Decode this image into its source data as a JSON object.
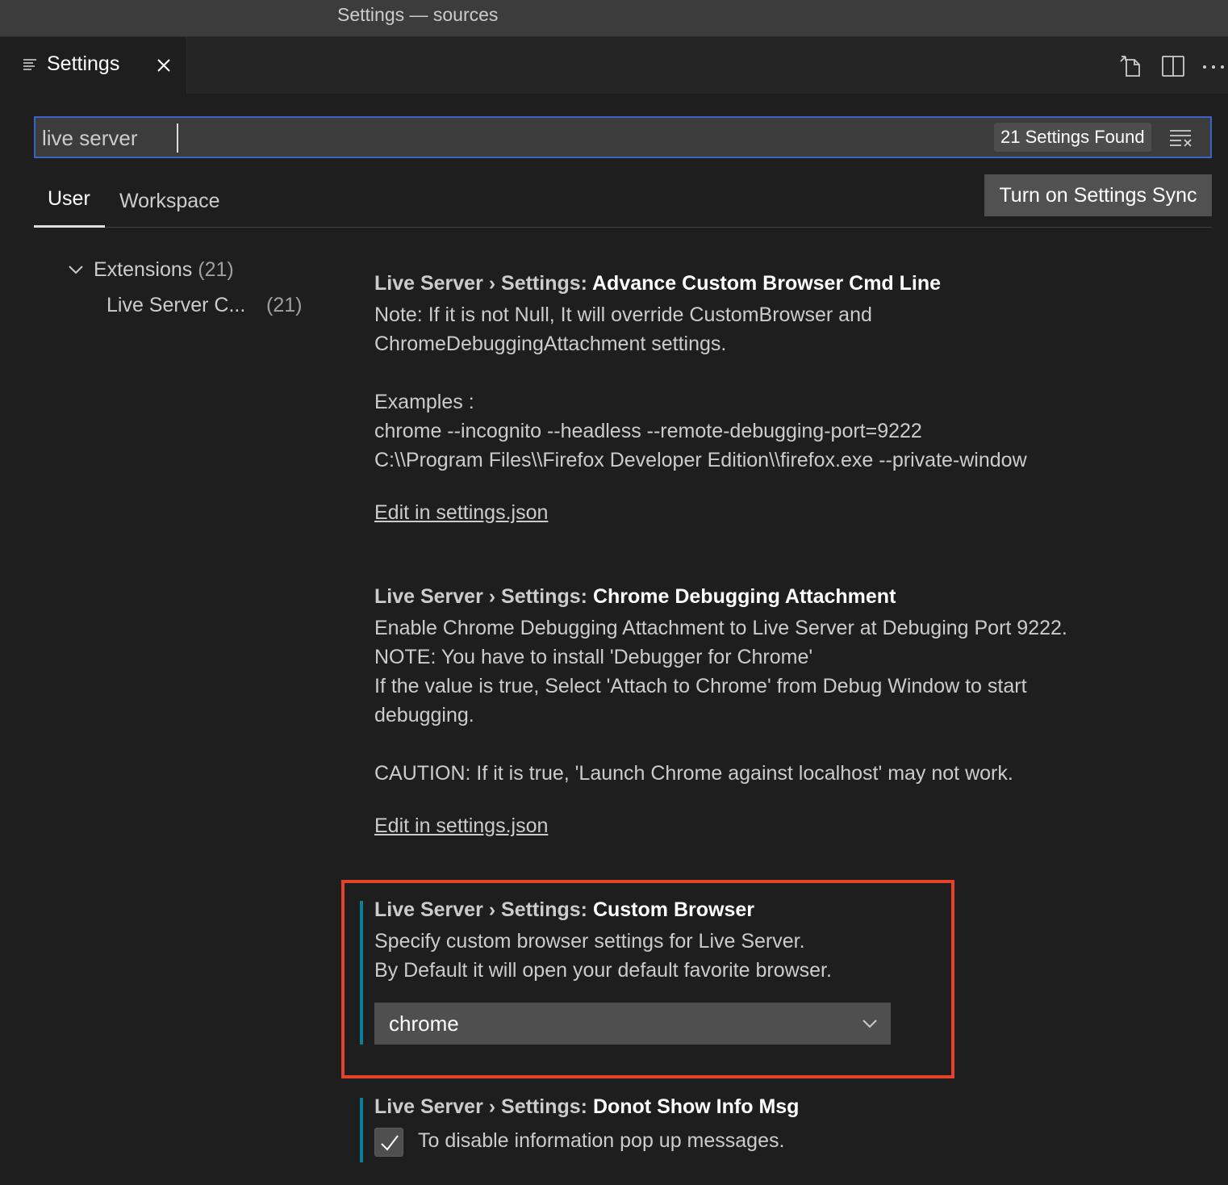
{
  "window": {
    "title": "Settings — sources"
  },
  "editor_tab": {
    "label": "Settings",
    "icon": "settings-list-icon",
    "close_icon": "close-icon"
  },
  "tab_actions": [
    {
      "name": "open-settings-json-icon"
    },
    {
      "name": "split-editor-icon"
    },
    {
      "name": "more-actions-icon"
    }
  ],
  "search": {
    "value": "live server",
    "results_badge": "21 Settings Found",
    "clear_icon": "clear-filter-icon"
  },
  "scope_tabs": {
    "user": "User",
    "workspace": "Workspace",
    "active": "User"
  },
  "sync_button": {
    "label": "Turn on Settings Sync"
  },
  "toc": {
    "extensions": {
      "label": "Extensions",
      "count": "(21)"
    },
    "live_server": {
      "label": "Live Server C...",
      "count": "(21)"
    }
  },
  "settings": [
    {
      "category": "Live Server › Settings: ",
      "name": "Advance Custom Browser Cmd Line",
      "description": [
        "Note: If it is not Null, It will override CustomBrowser and",
        "ChromeDebuggingAttachment settings.",
        "",
        "Examples :",
        "chrome --incognito --headless --remote-debugging-port=9222",
        "C:\\\\Program Files\\\\Firefox Developer Edition\\\\firefox.exe --private-window"
      ],
      "link": "Edit in settings.json"
    },
    {
      "category": "Live Server › Settings: ",
      "name": "Chrome Debugging Attachment",
      "description": [
        "Enable Chrome Debugging Attachment to Live Server at Debuging Port 9222.",
        "NOTE: You have to install 'Debugger for Chrome'",
        "If the value is true, Select 'Attach to Chrome' from Debug Window to start",
        "debugging.",
        "",
        "CAUTION: If it is true, 'Launch Chrome against localhost' may not work."
      ],
      "link": "Edit in settings.json"
    },
    {
      "category": "Live Server › Settings: ",
      "name": "Custom Browser",
      "description": [
        "Specify custom browser settings for Live Server.",
        "By Default it will open your default favorite browser."
      ],
      "select_value": "chrome",
      "modified": true,
      "highlighted": true
    },
    {
      "category": "Live Server › Settings: ",
      "name": "Donot Show Info Msg",
      "checkbox_label": "To disable information pop up messages.",
      "checked": true,
      "modified": true
    }
  ],
  "colors": {
    "background": "#1e1e1e",
    "focus_border": "#3a63c7",
    "modified_indicator": "#0c7d9d",
    "highlight_box": "#e4422b"
  }
}
